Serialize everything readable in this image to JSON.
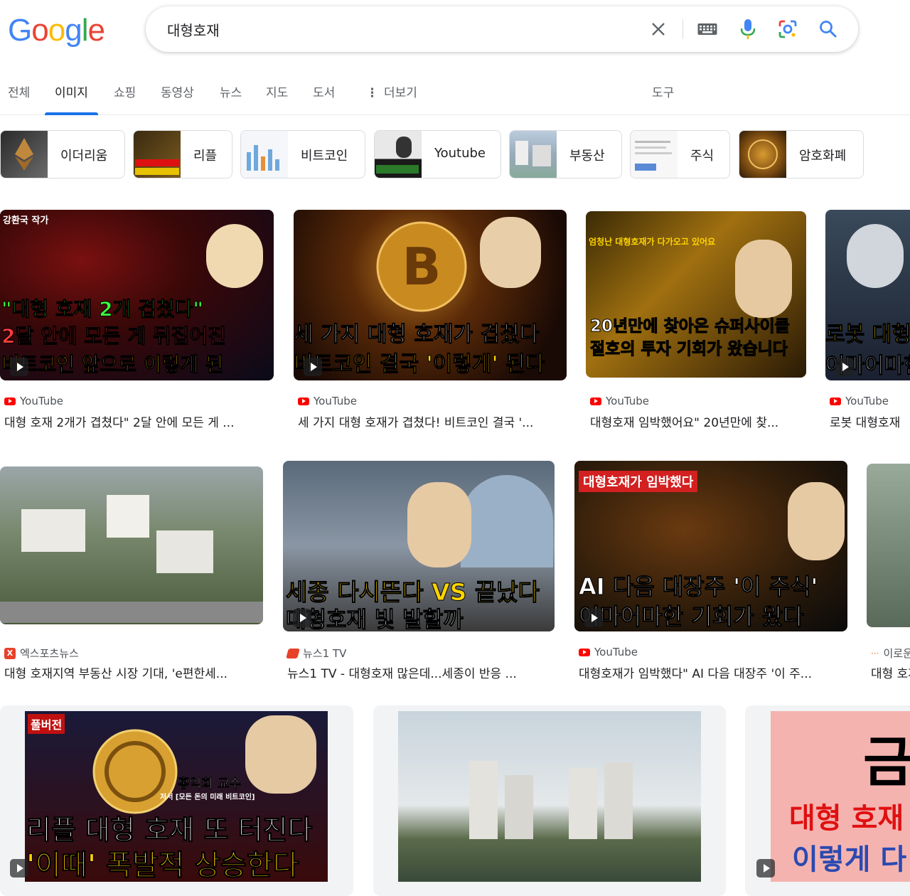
{
  "logo": {
    "letters": [
      "G",
      "o",
      "o",
      "g",
      "l",
      "e"
    ],
    "colors": [
      "#4285F4",
      "#EA4335",
      "#FBBC05",
      "#4285F4",
      "#34A853",
      "#EA4335"
    ]
  },
  "search": {
    "value": "대형호재"
  },
  "tabs": [
    {
      "label": "전체"
    },
    {
      "label": "이미지",
      "active": true
    },
    {
      "label": "쇼핑"
    },
    {
      "label": "동영상"
    },
    {
      "label": "뉴스"
    },
    {
      "label": "지도"
    },
    {
      "label": "도서"
    },
    {
      "label": "더보기"
    },
    {
      "label": "도구"
    }
  ],
  "chips": [
    {
      "label": "이더리움"
    },
    {
      "label": "리플"
    },
    {
      "label": "비트코인"
    },
    {
      "label": "Youtube"
    },
    {
      "label": "부동산"
    },
    {
      "label": "주식"
    },
    {
      "label": "암호화폐"
    }
  ],
  "results": [
    {
      "source": "YouTube",
      "title": "대형 호재 2개가 겹쳤다\" 2달 안에 모든 게 ...",
      "ov1": "강환국 작가",
      "ov2": "\"대형 호재 2개 겹쳤다\"",
      "ov3": "2달 안에 모든 게 뒤집어진",
      "ov4": "비트코인 앞으로 이렇게 된"
    },
    {
      "source": "YouTube",
      "title": "세 가지 대형 호재가 겹쳤다! 비트코인 결국 '...",
      "ov1": "세 가지 대형 호재가 겹쳤다",
      "ov2": "비트코인 결국 '이렇게' 된다"
    },
    {
      "source": "YouTube",
      "title": "대형호재 임박했어요\" 20년만에 찾...",
      "ov1": "엄청난 대형호재가 다가오고 있어요",
      "ov2": "20년만에 찾아온 슈퍼사이클",
      "ov3": "절호의 투자 기회가 왔습니다"
    },
    {
      "source": "YouTube",
      "title": "로봇 대형호재",
      "ov1": "로봇 대형",
      "ov2": "어마어마한"
    },
    {
      "source": "엑스포츠뉴스",
      "title": "대형 호재지역 부동산 시장 기대, 'e편한세..."
    },
    {
      "source": "뉴스1 TV",
      "title": "뉴스1 TV - 대형호재 많은데...세종이 반응 ...",
      "ov1": "세종 다시뜬다 VS 끝났다",
      "ov2": "대형호재 빛 발할까"
    },
    {
      "source": "YouTube",
      "title": "대형호재가 임박했다\" AI 다음 대장주 '이 주...",
      "ov1": "대형호재가 임박했다",
      "ov2": "AI 다음 대장주 '이 주식'",
      "ov3": "어마어마한 기회가 왔다"
    },
    {
      "source": "이로운",
      "title": "대형 호재"
    },
    {
      "source": "",
      "title": "",
      "ov1": "풀버전",
      "ov2": "홍익희 교수",
      "ov3": "저서 [모든 돈의 미래 비트코인]",
      "ov4": "리플 대형 호재 또 터진다",
      "ov5": "'이때' 폭발적 상승한다"
    },
    {
      "source": "",
      "title": ""
    },
    {
      "source": "",
      "title": "",
      "ov1": "금",
      "ov2": "대형 호재",
      "ov3": "이렇게 다"
    }
  ]
}
